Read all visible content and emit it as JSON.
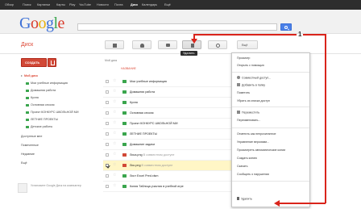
{
  "topnav": {
    "items": [
      "Обзор",
      "Поиск",
      "Картинки",
      "Карты",
      "Play",
      "YouTube",
      "Новости",
      "Почта",
      "Диск",
      "Календарь",
      "Ещё"
    ],
    "active": "Диск"
  },
  "logo_letters": [
    "G",
    "o",
    "o",
    "g",
    "l",
    "e"
  ],
  "app": {
    "title": "Диск",
    "create_label": "СОЗДАТЬ"
  },
  "toolbar": {
    "tooltip": "Удалить",
    "more_label": "Ещё"
  },
  "sidebar": {
    "items": [
      {
        "label": "Мой диск",
        "active": true,
        "arrow": true,
        "color": "#dd4b39"
      },
      {
        "label": "Мои учебные информация",
        "color": "#3aa54d"
      },
      {
        "label": "Домашняя работа",
        "color": "#3aa54d"
      },
      {
        "label": "Кухня",
        "color": "#3aa54d"
      },
      {
        "label": "Основная сессия",
        "color": "#3aa54d"
      },
      {
        "label": "Проект КОНКУРС ШКОЛЬНОЙ МИ",
        "color": "#3aa54d"
      },
      {
        "label": "ЛЕТНИЕ ПРОЕКТЫ",
        "color": "#3aa54d"
      },
      {
        "label": "Детские работы",
        "color": "#3aa54d"
      },
      {
        "label": "Доступные мне"
      },
      {
        "label": "Помеченные"
      },
      {
        "label": "Недавние"
      },
      {
        "label": "Ещё"
      }
    ],
    "desktop_app": "Установите Google Диск на компьютер"
  },
  "list": {
    "column_header": "Мой диск",
    "sort_label": "НАЗВАНИЕ",
    "rows": [
      {
        "name": "Мои учебные информация",
        "shared": "",
        "color": "#3aa54d"
      },
      {
        "name": "Домашняя работа",
        "shared": "",
        "color": "#3aa54d"
      },
      {
        "name": "Кухня",
        "shared": "",
        "color": "#3aa54d"
      },
      {
        "name": "Основная сессия",
        "shared": "",
        "color": "#3aa54d"
      },
      {
        "name": "Проект КОНКУРС ШКОЛЬНОЙ МИ",
        "shared": "",
        "color": "#3aa54d"
      },
      {
        "name": "ЛЕТНИЕ ПРОЕКТЫ",
        "shared": "",
        "color": "#3aa54d"
      },
      {
        "name": "Домашние задачи",
        "shared": "",
        "color": "#3aa54d"
      },
      {
        "name": "Лиса.png",
        "shared": "В совместном доступе",
        "color": "#d14836"
      },
      {
        "name": "Лис.png",
        "shared": "В совместном доступе",
        "color": "#d14836",
        "selected": true
      },
      {
        "name": "Лист Excel Pred.xlsm",
        "shared": "",
        "color": "#3aa54d"
      },
      {
        "name": "Копия Таблица участия в учебной игре",
        "shared": "",
        "color": "#3aa54d"
      }
    ]
  },
  "menu": {
    "items": [
      {
        "label": "Просмотр",
        "icon": ""
      },
      {
        "label": "Открыть с помощью",
        "icon": ""
      },
      {
        "label": "Совместный доступ...",
        "icon": "share-icon"
      },
      {
        "label": "Добавить в папку",
        "icon": "folder-icon"
      },
      {
        "label": "Пометить",
        "icon": ""
      },
      {
        "label": "Убрать из списка доступ",
        "icon": ""
      },
      {
        "label": "Переместить",
        "icon": "folder-icon"
      },
      {
        "label": "Переименовать...",
        "icon": ""
      },
      {
        "label": "Отметить как непрочитанное",
        "icon": ""
      },
      {
        "label": "Управление версиями...",
        "icon": ""
      },
      {
        "label": "Просмотреть автоматические копии",
        "icon": ""
      },
      {
        "label": "Создать копию",
        "icon": ""
      },
      {
        "label": "Скачать",
        "icon": ""
      },
      {
        "label": "Сообщить о нарушении",
        "icon": ""
      },
      {
        "label": "Удалить",
        "icon": "trash-icon"
      }
    ]
  },
  "annotation": {
    "label": "1"
  }
}
